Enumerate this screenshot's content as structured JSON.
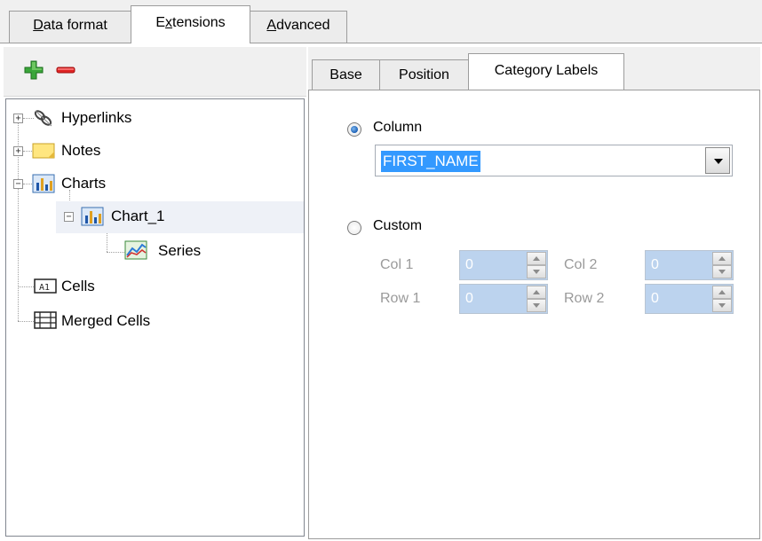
{
  "top_tabs": {
    "data_format": {
      "pre": "",
      "u": "D",
      "post": "ata format"
    },
    "extensions": {
      "pre": "E",
      "u": "x",
      "post": "tensions"
    },
    "advanced": {
      "pre": "",
      "u": "A",
      "post": "dvanced"
    }
  },
  "toolbar": {
    "add_icon": "plus-icon",
    "remove_icon": "minus-icon",
    "add_color": "#2f9e2f",
    "remove_color": "#d42020"
  },
  "tree": {
    "hyperlinks": "Hyperlinks",
    "notes": "Notes",
    "charts": "Charts",
    "chart_1": "Chart_1",
    "series": "Series",
    "cells": "Cells",
    "merged_cells": "Merged Cells",
    "expander_plus": "+",
    "expander_minus": "−"
  },
  "sub_tabs": {
    "base": "Base",
    "position": "Position",
    "category_labels": "Category Labels"
  },
  "category_labels": {
    "column_label": "Column",
    "column_value": "FIRST_NAME",
    "custom_label": "Custom",
    "col1_label": "Col 1",
    "col1_value": "0",
    "col2_label": "Col 2",
    "col2_value": "0",
    "row1_label": "Row 1",
    "row1_value": "0",
    "row2_label": "Row 2",
    "row2_value": "0",
    "selected_option": "Column"
  },
  "colors": {
    "selection": "#3399ff",
    "disabled_field": "#bcd3ee",
    "disabled_text": "#9a9a9a"
  }
}
